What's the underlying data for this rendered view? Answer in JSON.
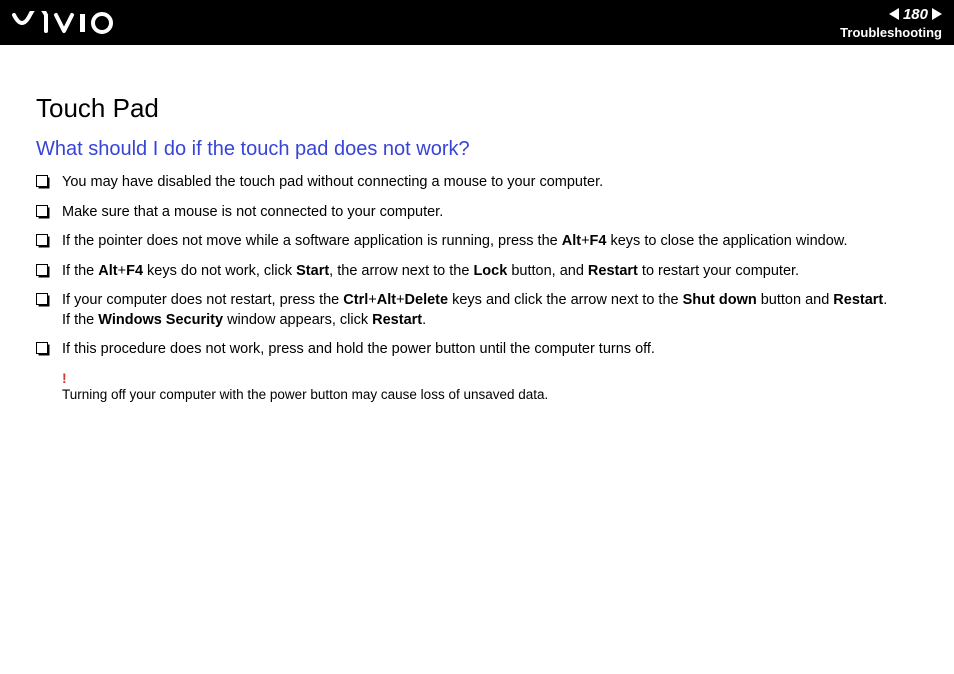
{
  "header": {
    "page_number": "180",
    "breadcrumb": "Troubleshooting"
  },
  "content": {
    "title": "Touch Pad",
    "sub_heading": "What should I do if the touch pad does not work?",
    "bullets": [
      {
        "text": "You may have disabled the touch pad without connecting a mouse to your computer."
      },
      {
        "text": "Make sure that a mouse is not connected to your computer."
      },
      {
        "html": "If the pointer does not move while a software application is running, press the <b>Alt</b>+<b>F4</b> keys to close the application window."
      },
      {
        "html": "If the <b>Alt</b>+<b>F4</b> keys do not work, click <b>Start</b>, the arrow next to the <b>Lock</b> button, and <b>Restart</b> to restart your computer."
      },
      {
        "html": "If your computer does not restart, press the <b>Ctrl</b>+<b>Alt</b>+<b>Delete</b> keys and click the arrow next to the <b>Shut down</b> button and <b>Restart</b>.<br>If the <b>Windows Security</b> window appears, click <b>Restart</b>."
      },
      {
        "text": "If this procedure does not work, press and hold the power button until the computer turns off."
      }
    ],
    "warning": {
      "mark": "!",
      "text": "Turning off your computer with the power button may cause loss of unsaved data."
    }
  }
}
